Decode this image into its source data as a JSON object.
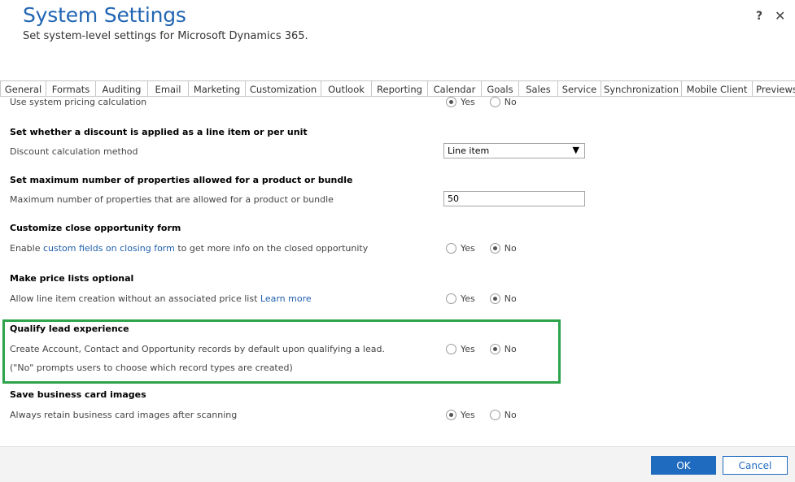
{
  "header": {
    "title": "System Settings",
    "subtitle": "Set system-level settings for Microsoft Dynamics 365.",
    "help_label": "?",
    "close_label": "✕"
  },
  "tabs": [
    {
      "label": "General"
    },
    {
      "label": "Formats"
    },
    {
      "label": "Auditing"
    },
    {
      "label": "Email"
    },
    {
      "label": "Marketing"
    },
    {
      "label": "Customization"
    },
    {
      "label": "Outlook"
    },
    {
      "label": "Reporting"
    },
    {
      "label": "Calendar"
    },
    {
      "label": "Goals"
    },
    {
      "label": "Sales"
    },
    {
      "label": "Service"
    },
    {
      "label": "Synchronization"
    },
    {
      "label": "Mobile Client"
    },
    {
      "label": "Previews"
    }
  ],
  "settings": {
    "pricing": {
      "label": "Use system pricing calculation",
      "yes": "Yes",
      "no": "No",
      "selected": "Yes"
    },
    "discount": {
      "title": "Set whether a discount is applied as a line item or per unit",
      "label": "Discount calculation method",
      "value": "Line item",
      "arrow": "▼"
    },
    "max_props": {
      "title": "Set maximum number of properties allowed for a product or bundle",
      "label": "Maximum number of properties that are allowed for a product or bundle",
      "value": "50"
    },
    "close_opp": {
      "title": "Customize close opportunity form",
      "label_prefix": "Enable ",
      "link": "custom fields on closing form",
      "label_suffix": " to get more info on the closed opportunity",
      "yes": "Yes",
      "no": "No",
      "selected": "No"
    },
    "price_lists": {
      "title": "Make price lists optional",
      "label_prefix": "Allow line item creation without an associated price list ",
      "link": "Learn more",
      "yes": "Yes",
      "no": "No",
      "selected": "No"
    },
    "qualify_lead": {
      "title": "Qualify lead experience",
      "label": "Create Account, Contact and Opportunity records by default upon qualifying a lead.",
      "note": "(\"No\" prompts users to choose which record types are created)",
      "yes": "Yes",
      "no": "No",
      "selected": "No"
    },
    "business_card": {
      "title": "Save business card images",
      "label": "Always retain business card images after scanning",
      "yes": "Yes",
      "no": "No",
      "selected": "Yes"
    }
  },
  "footer": {
    "ok_label": "OK",
    "cancel_label": "Cancel"
  },
  "colors": {
    "accent": "#1f6bbf",
    "title": "#2266b3",
    "highlight": "#2ea34a"
  }
}
